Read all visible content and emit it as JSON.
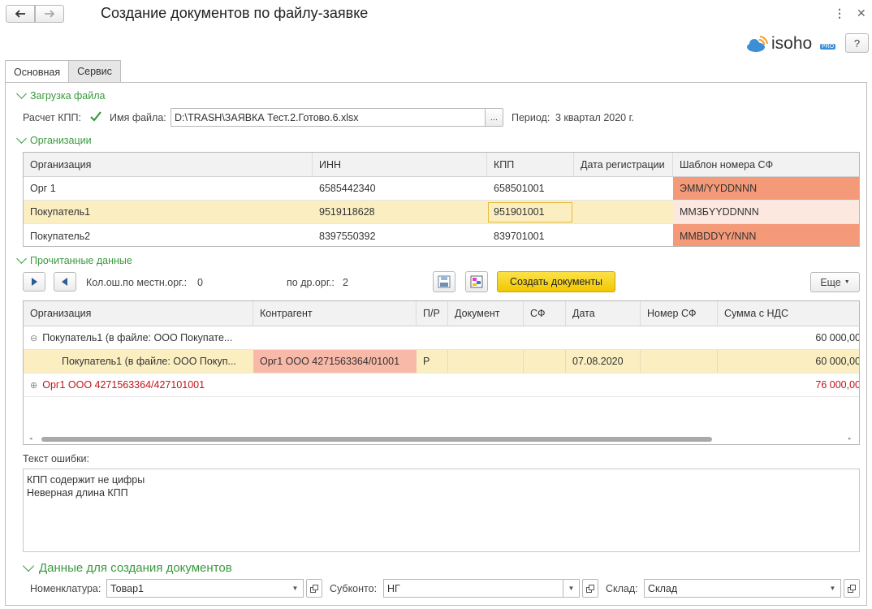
{
  "header": {
    "title": "Создание документов по файлу-заявке",
    "help_label": "?",
    "logo_text": "isoho",
    "logo_badge": "PRO"
  },
  "tabs": [
    {
      "label": "Основная",
      "active": true
    },
    {
      "label": "Сервис",
      "active": false
    }
  ],
  "file_section": {
    "title": "Загрузка файла",
    "kpp_calc_label": "Расчет КПП:",
    "kpp_calc_checked": true,
    "file_name_label": "Имя файла:",
    "file_name_value": "D:\\TRASH\\ЗАЯВКА Тест.2.Готово.6.xlsx",
    "browse_label": "...",
    "period_label": "Период:",
    "period_value": "3 квартал 2020 г."
  },
  "orgs_section": {
    "title": "Организации",
    "columns": [
      "Организация",
      "ИНН",
      "КПП",
      "Дата регистрации",
      "Шаблон номера СФ"
    ],
    "rows": [
      {
        "org": "Орг 1",
        "inn": "6585442340",
        "kpp": "658501001",
        "date": "",
        "template": "ЭММ/YYDDNNN"
      },
      {
        "org": "Покупатель1",
        "inn": "9519118628",
        "kpp": "951901001",
        "date": "",
        "template": "МM3БYYDDNNN"
      },
      {
        "org": "Покупатель2",
        "inn": "8397550392",
        "kpp": "839701001",
        "date": "",
        "template": "MMBDDYY/NNN"
      }
    ]
  },
  "read_section": {
    "title": "Прочитанные данные",
    "local_errors_label": "Кол.ош.по местн.орг.:",
    "local_errors_value": "0",
    "other_errors_label": "по др.орг.:",
    "other_errors_value": "2",
    "create_button": "Создать документы",
    "more_button": "Еще",
    "columns": [
      "Организация",
      "Контрагент",
      "П/Р",
      "Документ",
      "СФ",
      "Дата",
      "Номер СФ",
      "Сумма с НДС"
    ],
    "rows": [
      {
        "expander": "⊖",
        "org": "Покупатель1 (в файле: ООО Покупате...",
        "contractor": "",
        "pr": "",
        "doc": "",
        "sf": "",
        "date": "",
        "num": "",
        "sum": "60 000,00"
      },
      {
        "expander": "",
        "org": "Покупатель1 (в файле: ООО Покуп...",
        "contractor": "Орг1 ООО 4271563364/01001",
        "pr": "Р",
        "doc": "",
        "sf": "",
        "date": "07.08.2020",
        "num": "",
        "sum": "60 000,00"
      },
      {
        "expander": "⊕",
        "org": "Орг1 ООО 4271563364/427101001",
        "contractor": "",
        "pr": "",
        "doc": "",
        "sf": "",
        "date": "",
        "num": "",
        "sum": "76 000,00"
      }
    ]
  },
  "error_section": {
    "label": "Текст ошибки:",
    "lines": [
      "КПП содержит не цифры",
      "Неверная длина КПП"
    ]
  },
  "create_section": {
    "title": "Данные для создания документов",
    "nomenclature_label": "Номенклатура:",
    "nomenclature_value": "Товар1",
    "subkonto_label": "Субконто:",
    "subkonto_value": "НГ",
    "warehouse_label": "Склад:",
    "warehouse_value": "Склад"
  },
  "colors": {
    "accent_green": "#3a9a3e",
    "selected_row": "#fbefc2",
    "error_orange": "#f49a79",
    "error_red": "#c2131a",
    "create_button_yellow": "#f6d20a"
  }
}
